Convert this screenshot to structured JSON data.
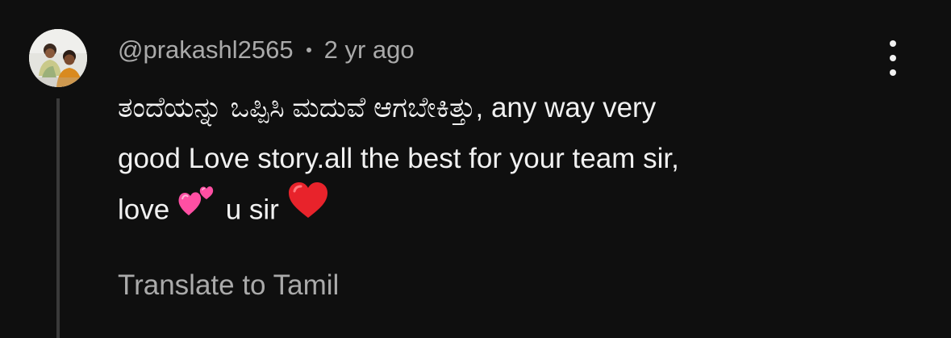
{
  "comment": {
    "author": "@prakashl2565",
    "timestamp": "2 yr ago",
    "text_lines": [
      "ತಂದೆಯನ್ನು ಒಪ್ಪಿಸಿ ಮದುವೆ ಆಗಬೇಕಿತ್ತು, any way very",
      "good Love story.all the best for your team sir,"
    ],
    "line3_part1": "love",
    "line3_part2": "u sir",
    "emoji_1": "two-hearts",
    "emoji_2": "red-heart",
    "translate_label": "Translate to Tamil",
    "more_icon": "kebab-menu-icon"
  },
  "colors": {
    "background": "#0f0f0f",
    "primary_text": "#f1f1f1",
    "secondary_text": "#aaaaaa",
    "thread_line": "#3a3a3a",
    "heart_pink": "#ff4fa3",
    "heart_red": "#e8232b"
  }
}
